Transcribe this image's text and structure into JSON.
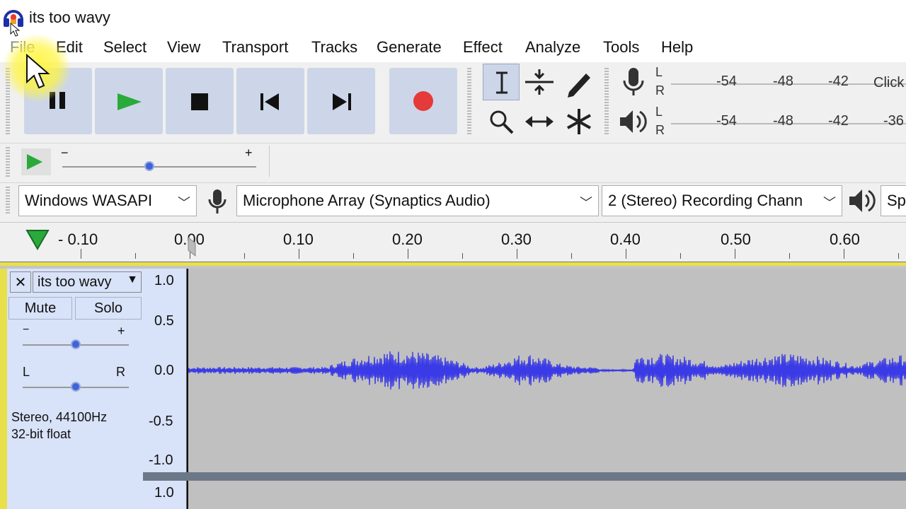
{
  "window": {
    "title": "its too wavy"
  },
  "menu": {
    "items": [
      "File",
      "Edit",
      "Select",
      "View",
      "Transport",
      "Tracks",
      "Generate",
      "Effect",
      "Analyze",
      "Tools",
      "Help"
    ]
  },
  "meters": {
    "record": {
      "l": "L",
      "r": "R",
      "ticks": [
        "-54",
        "-48",
        "-42"
      ],
      "hint": "Click"
    },
    "playback": {
      "l": "L",
      "r": "R",
      "ticks": [
        "-54",
        "-48",
        "-42",
        "-36"
      ]
    }
  },
  "playspeed": {
    "minus": "−",
    "plus": "+",
    "speed_fraction": 0.45
  },
  "devices": {
    "host": "Windows WASAPI",
    "input_device": "Microphone Array (Synaptics Audio)",
    "channels": "2 (Stereo) Recording Chann",
    "output_device": "Sp"
  },
  "timeline": {
    "labels": [
      "- 0.10",
      "0.00",
      "0.10",
      "0.20",
      "0.30",
      "0.40",
      "0.50",
      "0.60"
    ]
  },
  "track": {
    "name": "its too wavy",
    "close": "✕",
    "mute": "Mute",
    "solo": "Solo",
    "gain": {
      "minus": "−",
      "plus": "+",
      "fraction": 0.5
    },
    "pan": {
      "left": "L",
      "right": "R",
      "fraction": 0.5
    },
    "info_line1": "Stereo, 44100Hz",
    "info_line2": "32-bit float",
    "ruler": [
      "1.0",
      "0.5",
      "0.0",
      "-0.5",
      "-1.0"
    ],
    "ruler2": "1.0"
  },
  "colors": {
    "waveform": "#3a3ae6",
    "record": "#e53a3a",
    "play": "#2aaa3a",
    "selection_accent": "#e8e04a"
  }
}
